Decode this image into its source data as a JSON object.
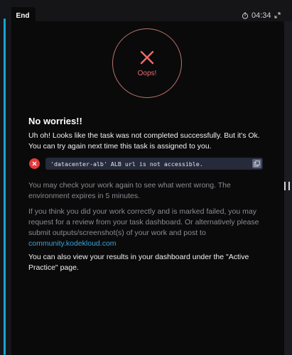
{
  "header": {
    "tab_label": "End",
    "timer": "04:34",
    "timer_icon": "stopwatch-icon",
    "expand_icon": "expand-icon"
  },
  "status": {
    "label": "Oops!",
    "icon": "x-icon",
    "color": "#ee6b6b"
  },
  "content": {
    "heading": "No worries!!",
    "intro": "Uh oh! Looks like the task was not completed successfully. But it's Ok. You can try again next time this task is assigned to you.",
    "error": {
      "icon": "error-x-icon",
      "message": "'datacenter-alb' ALB url is not accessible."
    },
    "check_again": "You may check your work again to see what went wrong. The environment expires in 5 minutes.",
    "review_text": "If you think you did your work correctly and is marked failed, you may request for a review from your task dashboard. Or alternatively please submit outputs/screenshot(s) of your work and post to",
    "review_link": "community.kodekloud.com",
    "results": "You can also view your results in your dashboard under the \"Active Practice\" page."
  },
  "colors": {
    "accent": "#1aa3d4",
    "error": "#e53b3b",
    "link": "#3aa3d5"
  }
}
